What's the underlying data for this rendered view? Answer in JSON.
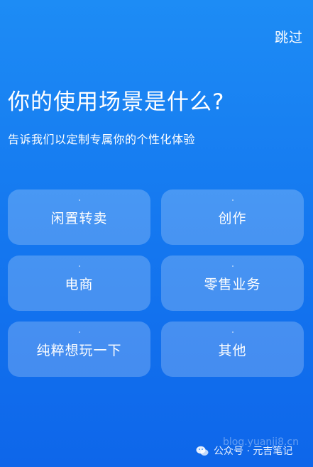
{
  "header": {
    "skip_label": "跳过"
  },
  "intro": {
    "title": "你的使用场景是什么?",
    "subtitle": "告诉我们以定制专属你的个性化体验"
  },
  "options": [
    {
      "label": "闲置转卖"
    },
    {
      "label": "创作"
    },
    {
      "label": "电商"
    },
    {
      "label": "零售业务"
    },
    {
      "label": "纯粹想玩一下"
    },
    {
      "label": "其他"
    }
  ],
  "watermark": {
    "url": "blog.yuanji8.cn",
    "text": "公众号 · 元吉笔记",
    "icon": "wechat-icon"
  },
  "colors": {
    "background_top": "#1d8cf5",
    "background_bottom": "#0e66ea",
    "card": "rgba(255,255,255,0.22)",
    "text": "#ffffff"
  }
}
